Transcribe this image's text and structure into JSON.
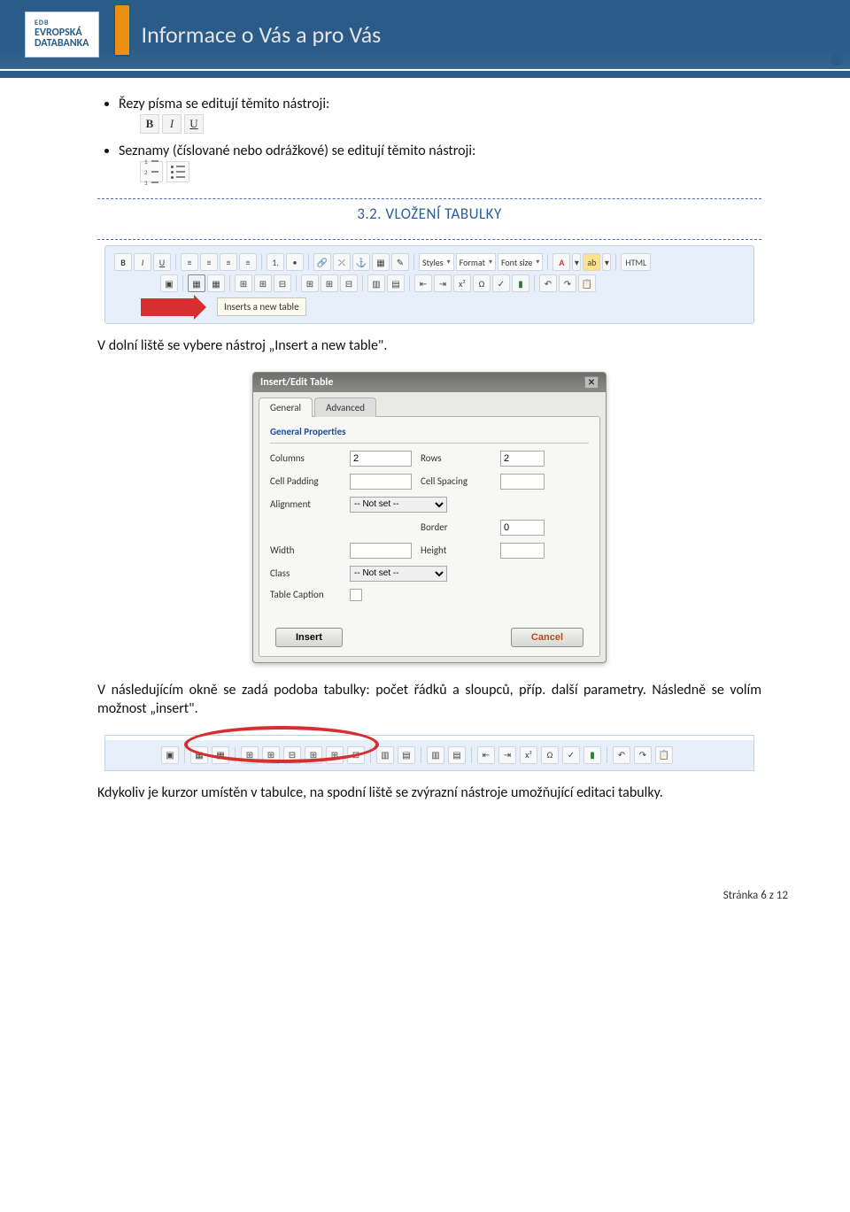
{
  "header": {
    "logo_top": "EDB",
    "logo_line1": "EVROPSKÁ",
    "logo_line2": "DATABANKA",
    "tagline": "Informace o Vás a pro Vás"
  },
  "bullets": {
    "item1": "Řezy písma se editují těmito nástroji:",
    "item2": "Seznamy (číslované nebo odrážkové) se editují těmito nástroji:"
  },
  "icons": {
    "bold": "B",
    "italic": "I",
    "underline": "U"
  },
  "section": {
    "number_title": "3.2.   VLOŽENÍ TABULKY",
    "toolbar_labels": {
      "styles": "Styles",
      "format": "Format",
      "fontsize": "Font size",
      "html": "HTML",
      "fontcolor": "A"
    },
    "tooltip": "Inserts a new table",
    "text_after_toolbar": "V dolní liště se vybere nástroj „Insert a new table\"."
  },
  "dialog": {
    "title": "Insert/Edit Table",
    "tabs": {
      "general": "General",
      "advanced": "Advanced"
    },
    "fieldset": "General Properties",
    "labels": {
      "columns": "Columns",
      "rows": "Rows",
      "cellpadding": "Cell Padding",
      "cellspacing": "Cell Spacing",
      "alignment": "Alignment",
      "border": "Border",
      "width": "Width",
      "height": "Height",
      "class": "Class",
      "tablecaption": "Table Caption"
    },
    "values": {
      "columns": "2",
      "rows": "2",
      "cellpadding": "",
      "cellspacing": "",
      "alignment": "-- Not set --",
      "border": "0",
      "width": "",
      "height": "",
      "class": "-- Not set --"
    },
    "buttons": {
      "insert": "Insert",
      "cancel": "Cancel"
    }
  },
  "text_after_dialog": "V následujícím okně se zadá podoba tabulky: počet řádků a sloupců, příp. další parametry. Následně se volím možnost „insert\".",
  "text_after_toolbar2": "Kdykoliv je kurzor umístěn v tabulce, na spodní liště se zvýrazní nástroje umožňující editaci tabulky.",
  "footer": "Stránka 6 z 12"
}
